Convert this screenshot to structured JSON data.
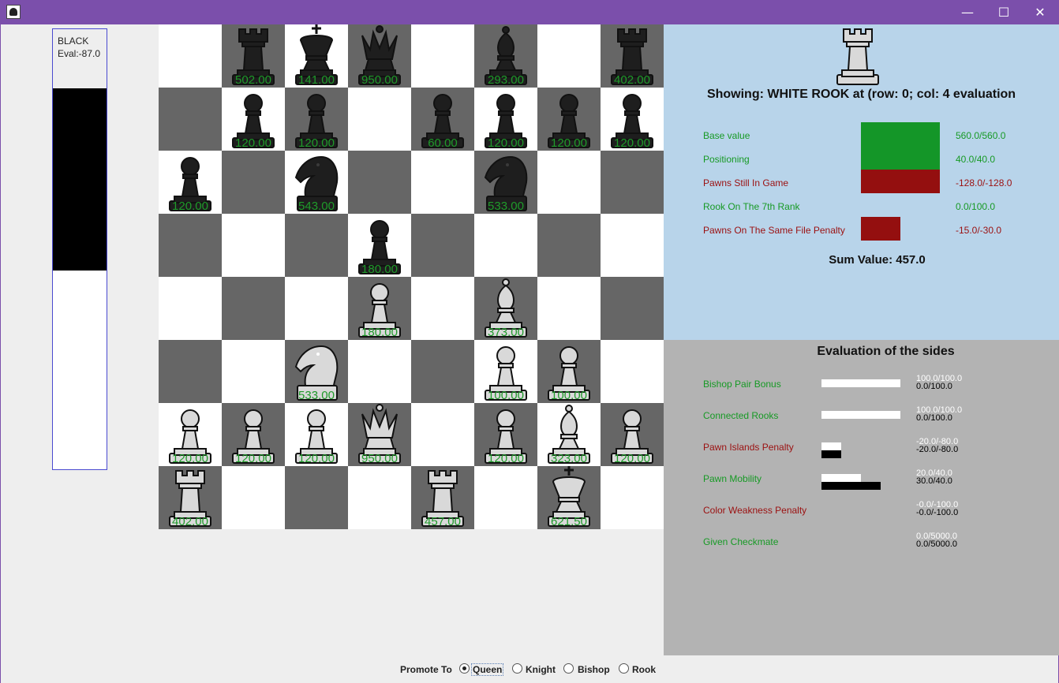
{
  "window": {
    "minimize": "—",
    "maximize": "☐",
    "close": "✕"
  },
  "eval_panel": {
    "side": "BLACK",
    "eval": "Eval:-87.0",
    "white_share": 0.45
  },
  "board": [
    {
      "r": 0,
      "c": 1,
      "color": "black",
      "type": "rook",
      "value": "502.00"
    },
    {
      "r": 0,
      "c": 2,
      "color": "black",
      "type": "king",
      "value": "141.00"
    },
    {
      "r": 0,
      "c": 3,
      "color": "black",
      "type": "queen",
      "value": "950.00"
    },
    {
      "r": 0,
      "c": 5,
      "color": "black",
      "type": "bishop",
      "value": "293.00"
    },
    {
      "r": 0,
      "c": 7,
      "color": "black",
      "type": "rook",
      "value": "402.00"
    },
    {
      "r": 1,
      "c": 1,
      "color": "black",
      "type": "pawn",
      "value": "120.00"
    },
    {
      "r": 1,
      "c": 2,
      "color": "black",
      "type": "pawn",
      "value": "120.00"
    },
    {
      "r": 1,
      "c": 4,
      "color": "black",
      "type": "pawn",
      "value": "60.00"
    },
    {
      "r": 1,
      "c": 5,
      "color": "black",
      "type": "pawn",
      "value": "120.00"
    },
    {
      "r": 1,
      "c": 6,
      "color": "black",
      "type": "pawn",
      "value": "120.00"
    },
    {
      "r": 1,
      "c": 7,
      "color": "black",
      "type": "pawn",
      "value": "120.00"
    },
    {
      "r": 2,
      "c": 0,
      "color": "black",
      "type": "pawn",
      "value": "120.00"
    },
    {
      "r": 2,
      "c": 2,
      "color": "black",
      "type": "knight",
      "value": "543.00"
    },
    {
      "r": 2,
      "c": 5,
      "color": "black",
      "type": "knight",
      "value": "533.00"
    },
    {
      "r": 3,
      "c": 3,
      "color": "black",
      "type": "pawn",
      "value": "180.00"
    },
    {
      "r": 4,
      "c": 3,
      "color": "white",
      "type": "pawn",
      "value": "180.00"
    },
    {
      "r": 4,
      "c": 5,
      "color": "white",
      "type": "bishop",
      "value": "373.00"
    },
    {
      "r": 5,
      "c": 2,
      "color": "white",
      "type": "knight",
      "value": "533.00"
    },
    {
      "r": 5,
      "c": 5,
      "color": "white",
      "type": "pawn",
      "value": "100.00"
    },
    {
      "r": 5,
      "c": 6,
      "color": "white",
      "type": "pawn",
      "value": "100.00"
    },
    {
      "r": 6,
      "c": 0,
      "color": "white",
      "type": "pawn",
      "value": "120.00"
    },
    {
      "r": 6,
      "c": 1,
      "color": "white",
      "type": "pawn",
      "value": "120.00"
    },
    {
      "r": 6,
      "c": 2,
      "color": "white",
      "type": "pawn",
      "value": "120.00"
    },
    {
      "r": 6,
      "c": 3,
      "color": "white",
      "type": "queen",
      "value": "950.00"
    },
    {
      "r": 6,
      "c": 5,
      "color": "white",
      "type": "pawn",
      "value": "120.00"
    },
    {
      "r": 6,
      "c": 6,
      "color": "white",
      "type": "bishop",
      "value": "323.00"
    },
    {
      "r": 6,
      "c": 7,
      "color": "white",
      "type": "pawn",
      "value": "120.00"
    },
    {
      "r": 7,
      "c": 0,
      "color": "white",
      "type": "rook",
      "value": "402.00"
    },
    {
      "r": 7,
      "c": 4,
      "color": "white",
      "type": "rook",
      "value": "457.00"
    },
    {
      "r": 7,
      "c": 6,
      "color": "white",
      "type": "king",
      "value": "621.50"
    }
  ],
  "detail": {
    "title": "Showing: WHITE ROOK at (row: 0; col: 4 evaluation",
    "piece": {
      "color": "white",
      "type": "rook"
    },
    "rows": [
      {
        "label": "Base value",
        "value": "560.0/560.0",
        "status": "positive",
        "fraction": 1.0
      },
      {
        "label": "Positioning",
        "value": "40.0/40.0",
        "status": "positive",
        "fraction": 1.0
      },
      {
        "label": "Pawns Still In Game",
        "value": "-128.0/-128.0",
        "status": "negative",
        "fraction": 1.0
      },
      {
        "label": "Rook On The 7th Rank",
        "value": "0.0/100.0",
        "status": "positive",
        "fraction": 0.0
      },
      {
        "label": "Pawns On The Same File Penalty",
        "value": "-15.0/-30.0",
        "status": "negative",
        "fraction": 0.5
      }
    ],
    "sum": "Sum Value: 457.0",
    "colors": {
      "positive": "#149628",
      "negative": "#940f0f"
    }
  },
  "sides": {
    "title": "Evaluation of the sides",
    "rows": [
      {
        "label": "Bishop Pair Bonus",
        "status": "positive",
        "white_value": "100.0/100.0",
        "black_value": "0.0/100.0",
        "white_fraction": 1.0,
        "black_fraction": 0.0
      },
      {
        "label": "Connected Rooks",
        "status": "positive",
        "white_value": "100.0/100.0",
        "black_value": "0.0/100.0",
        "white_fraction": 1.0,
        "black_fraction": 0.0
      },
      {
        "label": "Pawn Islands Penalty",
        "status": "negative",
        "white_value": "-20.0/-80.0",
        "black_value": "-20.0/-80.0",
        "white_fraction": 0.25,
        "black_fraction": 0.25
      },
      {
        "label": "Pawn Mobility",
        "status": "positive",
        "white_value": "20.0/40.0",
        "black_value": "30.0/40.0",
        "white_fraction": 0.5,
        "black_fraction": 0.75
      },
      {
        "label": "Color Weakness Penalty",
        "status": "negative",
        "white_value": "-0.0/-100.0",
        "black_value": "-0.0/-100.0",
        "white_fraction": 0.0,
        "black_fraction": 0.0
      },
      {
        "label": "Given Checkmate",
        "status": "positive",
        "white_value": "0.0/5000.0",
        "black_value": "0.0/5000.0",
        "white_fraction": 0.0,
        "black_fraction": 0.0
      }
    ]
  },
  "promote": {
    "label": "Promote To",
    "options": [
      {
        "label": "Queen",
        "selected": true
      },
      {
        "label": "Knight",
        "selected": false
      },
      {
        "label": "Bishop",
        "selected": false
      },
      {
        "label": "Rook",
        "selected": false
      }
    ]
  }
}
